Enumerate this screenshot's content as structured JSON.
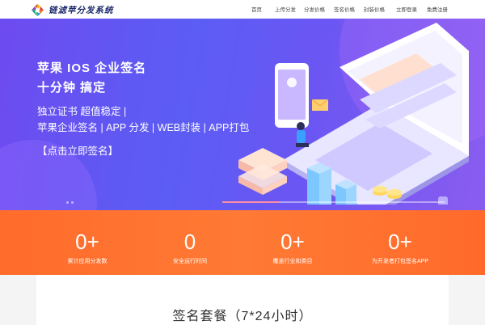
{
  "header": {
    "logo_text": "链滤苹分发系统",
    "nav": [
      "首页",
      "上传分发",
      "分发价格",
      "签名价格",
      "封装价格",
      "立即登录",
      "免费注册"
    ]
  },
  "hero": {
    "title_line1": "苹果 IOS 企业签名",
    "title_line2": "十分钟 搞定",
    "sub_line1": "独立证书 超值稳定 |",
    "sub_line2": "苹果企业签名 | APP 分发 | WEB封装 | APP打包",
    "cta": "【点击立即签名】"
  },
  "stats": [
    {
      "value": "0+",
      "label": "累计应用分发数"
    },
    {
      "value": "0",
      "label": "安全运行时间"
    },
    {
      "value": "0+",
      "label": "覆盖行业和类目"
    },
    {
      "value": "0+",
      "label": "为开发者打包签名APP"
    }
  ],
  "packages": {
    "title": "签名套餐（7*24小时）"
  },
  "colors": {
    "hero_start": "#6d4bf0",
    "hero_end": "#8a5cf0",
    "stats_bg": "#ff7a34",
    "logo_text": "#1b2a6b"
  },
  "icons": [
    "logo-mark-icon"
  ]
}
